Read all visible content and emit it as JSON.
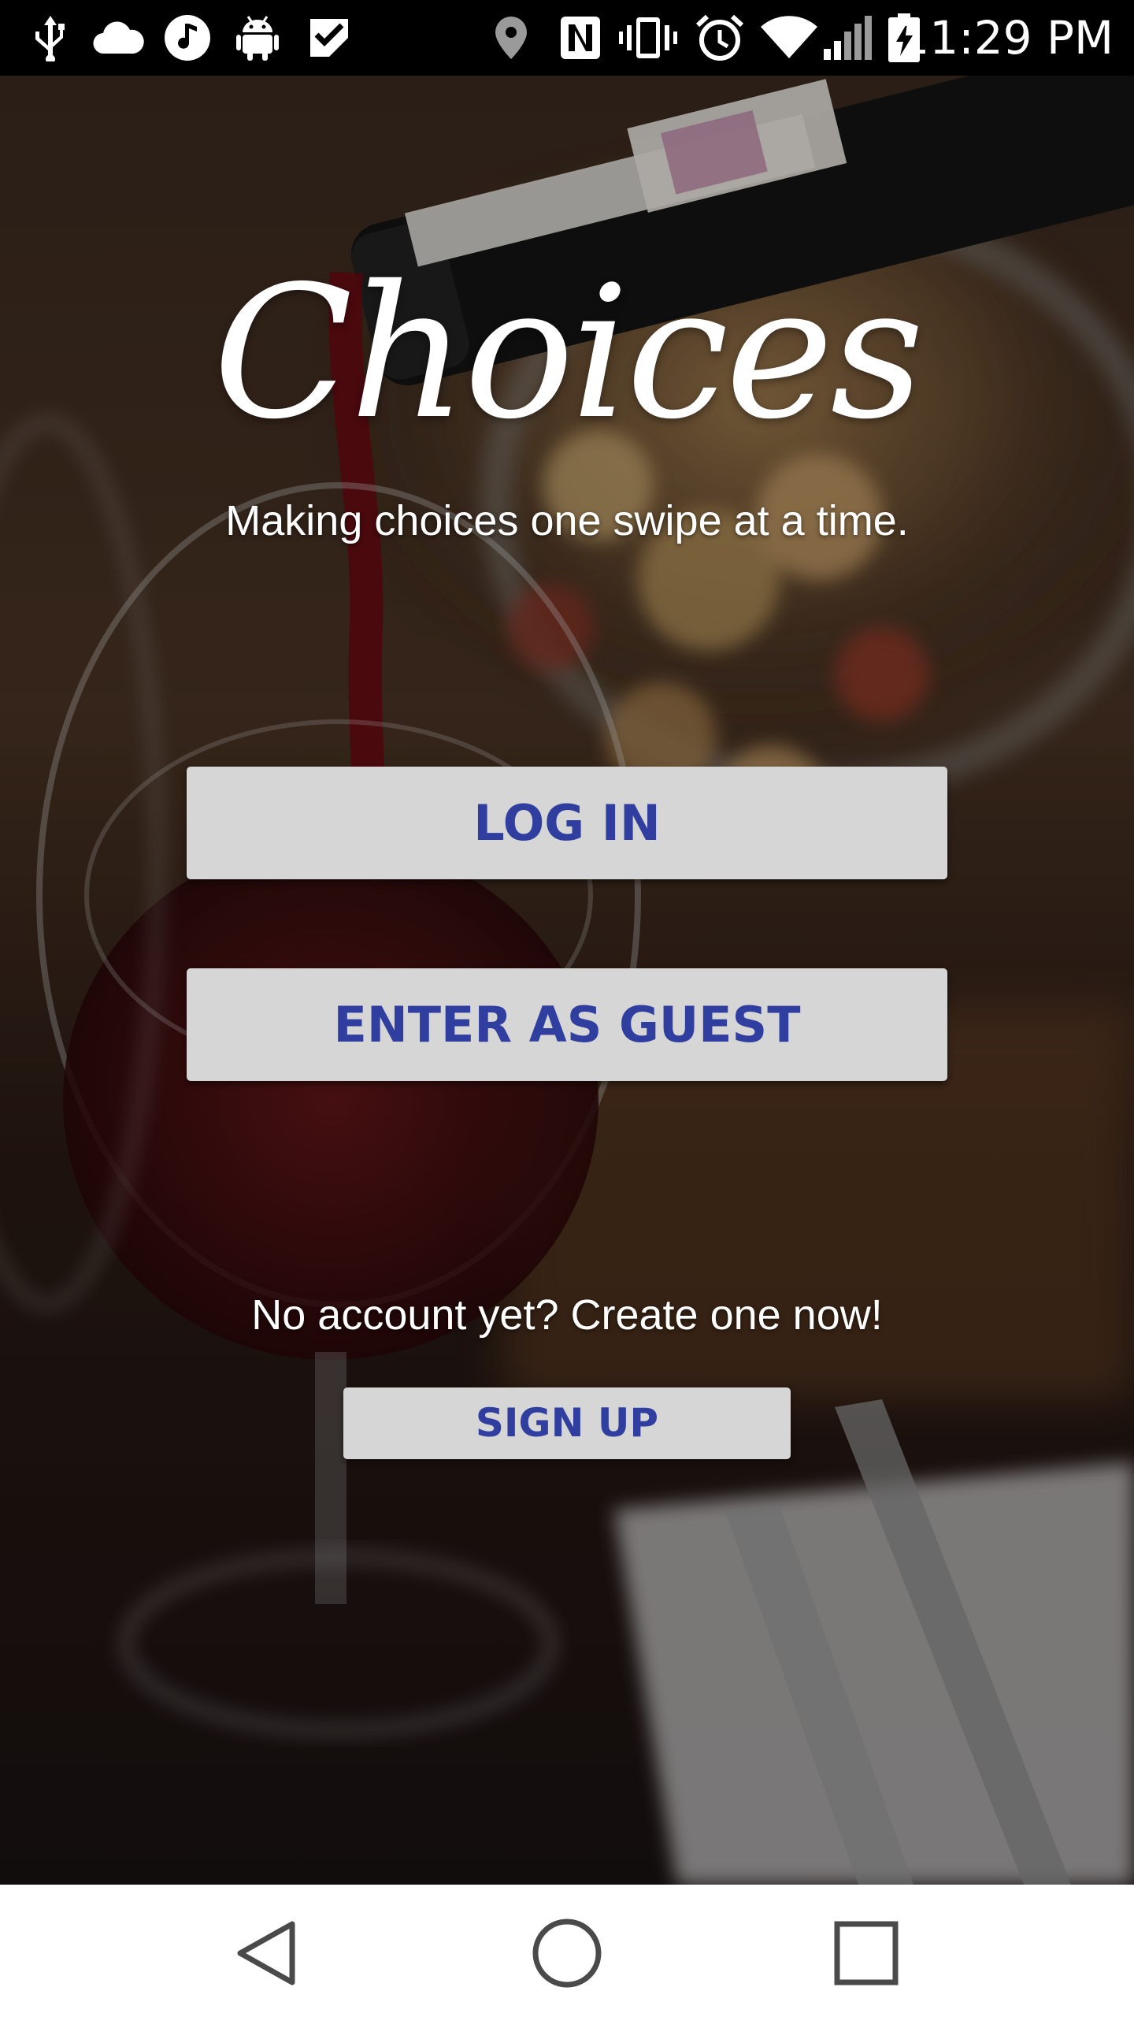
{
  "status_bar": {
    "time": "11:29 PM",
    "left_icons": [
      "usb-icon",
      "cloud-icon",
      "music-icon",
      "android-icon",
      "task-check-icon"
    ],
    "right_icons": [
      "location-icon",
      "nfc-icon",
      "vibrate-icon",
      "alarm-icon",
      "wifi-icon",
      "signal-icon",
      "battery-charging-icon"
    ]
  },
  "app": {
    "title": "Choices",
    "tagline": "Making choices one swipe at a time.",
    "login_label": "LOG IN",
    "guest_label": "ENTER AS GUEST",
    "no_account_text": "No account yet? Create one now!",
    "signup_label": "SIGN UP"
  },
  "background": {
    "description_icon": "wine-pour-photo"
  },
  "colors": {
    "button_bg": "#d6d6d6",
    "button_text": "#303f9f",
    "status_bar_bg": "#000000",
    "nav_bar_bg": "#ffffff",
    "nav_icon": "#4a4a4a"
  },
  "nav_bar": {
    "buttons": [
      "back-icon",
      "home-icon",
      "recents-icon"
    ]
  }
}
